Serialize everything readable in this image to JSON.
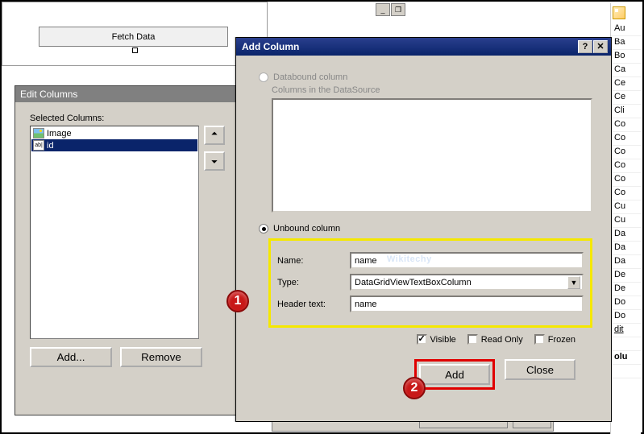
{
  "fetch": {
    "button_label": "Fetch Data"
  },
  "edit_columns": {
    "title": "Edit Columns",
    "selected_label": "Selected Columns:",
    "items": [
      {
        "label": "Image",
        "icon": "image-icon"
      },
      {
        "label": "id",
        "icon": "textbox-icon",
        "selected": true
      }
    ],
    "add_label": "Add...",
    "remove_label": "Remove"
  },
  "add_column": {
    "title": "Add Column",
    "radio_databound": "Databound column",
    "ds_label": "Columns in the DataSource",
    "radio_unbound": "Unbound column",
    "name_label": "Name:",
    "name_value": "name",
    "watermark": "Wikitechy",
    "type_label": "Type:",
    "type_value": "DataGridViewTextBoxColumn",
    "header_label": "Header text:",
    "header_value": "name",
    "visible_label": "Visible",
    "readonly_label": "Read Only",
    "frozen_label": "Frozen",
    "visible_checked": true,
    "readonly_checked": false,
    "frozen_checked": false,
    "add_btn": "Add",
    "close_btn": "Close"
  },
  "badges": {
    "b1": "1",
    "b2": "2"
  },
  "props": {
    "rows": [
      "Au",
      "Ba",
      "Bo",
      "Ca",
      "Ce",
      "Ce",
      "Cli",
      "Co",
      "Co",
      "Co",
      "Co",
      "Co",
      "Co",
      "Cu",
      "Cu",
      "Da",
      "Da",
      "Da",
      "De",
      "De",
      "Do",
      "Do"
    ],
    "edit_link": "dit",
    "bold_row": "olu"
  }
}
